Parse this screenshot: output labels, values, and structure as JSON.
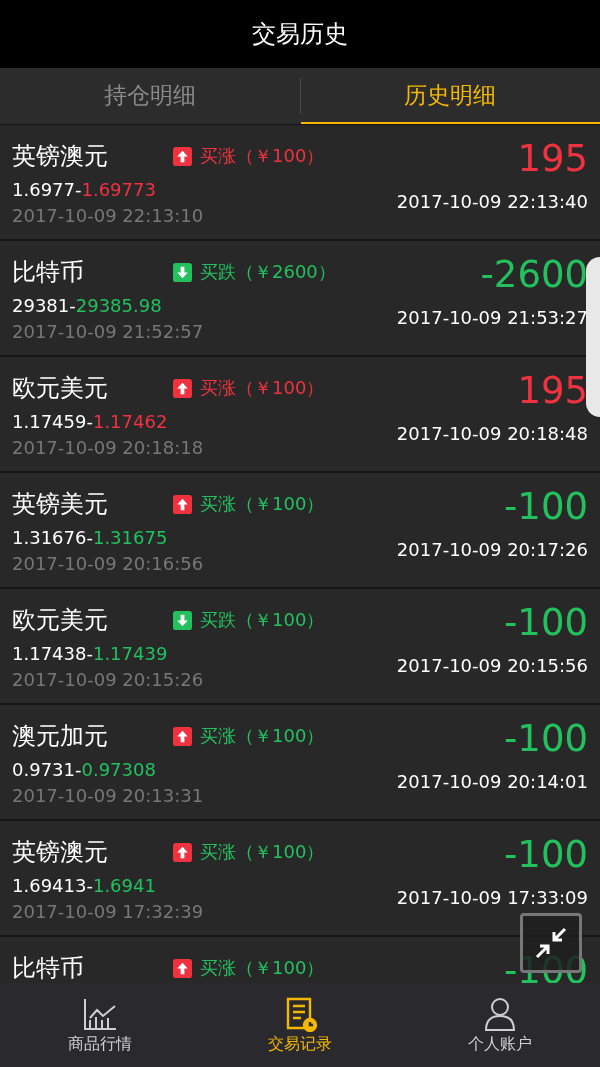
{
  "header": {
    "title": "交易历史"
  },
  "tabs": [
    {
      "label": "持仓明细",
      "selected": false
    },
    {
      "label": "历史明细",
      "selected": true
    }
  ],
  "trades": [
    {
      "name": "英镑澳元",
      "kind": "up",
      "color": "#f0323f",
      "trade": "买涨（￥100）",
      "open_price": "1.6977-",
      "close_price": "1.69773",
      "open_time": "2017-10-09 22:13:10",
      "profit": "195",
      "close_time": "2017-10-09 22:13:40"
    },
    {
      "name": "比特币",
      "kind": "down",
      "color": "#22c15e",
      "trade": "买跌（￥2600）",
      "open_price": "29381-",
      "close_price": "29385.98",
      "open_time": "2017-10-09 21:52:57",
      "profit": "-2600",
      "close_time": "2017-10-09 21:53:27"
    },
    {
      "name": "欧元美元",
      "kind": "up",
      "color": "#f0323f",
      "trade": "买涨（￥100）",
      "open_price": "1.17459-",
      "close_price": "1.17462",
      "open_time": "2017-10-09 20:18:18",
      "profit": "195",
      "close_time": "2017-10-09 20:18:48"
    },
    {
      "name": "英镑美元",
      "kind": "up",
      "color": "#22c15e",
      "trade": "买涨（￥100）",
      "open_price": "1.31676-",
      "close_price": "1.31675",
      "open_time": "2017-10-09 20:16:56",
      "profit": "-100",
      "close_time": "2017-10-09 20:17:26"
    },
    {
      "name": "欧元美元",
      "kind": "down",
      "color": "#22c15e",
      "trade": "买跌（￥100）",
      "open_price": "1.17438-",
      "close_price": "1.17439",
      "open_time": "2017-10-09 20:15:26",
      "profit": "-100",
      "close_time": "2017-10-09 20:15:56"
    },
    {
      "name": "澳元加元",
      "kind": "up",
      "color": "#22c15e",
      "trade": "买涨（￥100）",
      "open_price": "0.9731-",
      "close_price": "0.97308",
      "open_time": "2017-10-09 20:13:31",
      "profit": "-100",
      "close_time": "2017-10-09 20:14:01"
    },
    {
      "name": "英镑澳元",
      "kind": "up",
      "color": "#22c15e",
      "trade": "买涨（￥100）",
      "open_price": "1.69413-",
      "close_price": "1.6941",
      "open_time": "2017-10-09 17:32:39",
      "profit": "-100",
      "close_time": "2017-10-09 17:33:09"
    },
    {
      "name": "比特币",
      "kind": "up",
      "color": "#22c15e",
      "trade": "买涨（￥100）",
      "profit": "-100"
    }
  ],
  "bottom_nav": [
    {
      "label": "商品行情",
      "kind": "chart",
      "selected": false
    },
    {
      "label": "交易记录",
      "kind": "record",
      "selected": true
    },
    {
      "label": "个人账户",
      "kind": "person",
      "selected": false
    }
  ]
}
